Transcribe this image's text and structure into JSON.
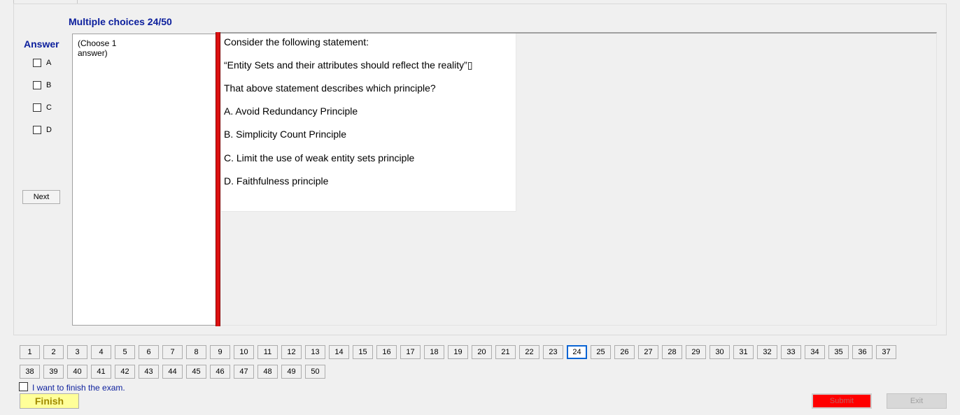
{
  "header": {
    "title": "Multiple choices 24/50"
  },
  "answer_panel": {
    "label": "Answer",
    "options": [
      {
        "label": "A",
        "checked": false
      },
      {
        "label": "B",
        "checked": false
      },
      {
        "label": "C",
        "checked": false
      },
      {
        "label": "D",
        "checked": false
      }
    ],
    "next_label": "Next"
  },
  "choose_hint": "(Choose 1 answer)",
  "question": {
    "lines": [
      "Consider the following statement:",
      "“Entity Sets and their attributes should reflect the reality”▯",
      "That above statement describes which principle?",
      "A.  Avoid Redundancy Principle",
      "B.  Simplicity Count Principle",
      "C.  Limit the use of weak entity sets principle",
      "D.  Faithfulness principle"
    ]
  },
  "navigation": {
    "current": 24,
    "numbers": [
      "1",
      "2",
      "3",
      "4",
      "5",
      "6",
      "7",
      "8",
      "9",
      "10",
      "11",
      "12",
      "13",
      "14",
      "15",
      "16",
      "17",
      "18",
      "19",
      "20",
      "21",
      "22",
      "23",
      "24",
      "25",
      "26",
      "27",
      "28",
      "29",
      "30",
      "31",
      "32",
      "33",
      "34",
      "35",
      "36",
      "37",
      "38",
      "39",
      "40",
      "41",
      "42",
      "43",
      "44",
      "45",
      "46",
      "47",
      "48",
      "49",
      "50"
    ]
  },
  "footer": {
    "finish_checkbox_label": "I want to finish the exam.",
    "finish_label": "Finish",
    "submit_label": "Submit",
    "exit_label": "Exit"
  },
  "colors": {
    "title_blue": "#0b1e9c",
    "red_bar": "#dd1111",
    "finish_yellow": "#ffff99",
    "submit_red": "#ff0000",
    "current_border": "#0a64d4"
  }
}
